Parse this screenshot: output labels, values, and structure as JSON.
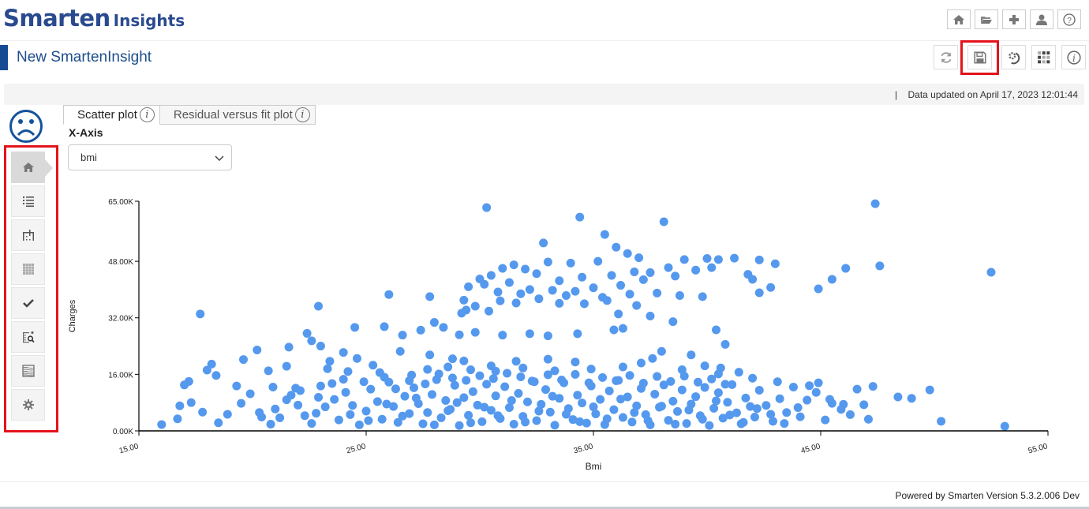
{
  "app": {
    "logo_main": "Smarten",
    "logo_sub": "Insights",
    "page_title": "New SmartenInsight",
    "top_icons": [
      "home-icon",
      "folder-open-icon",
      "plus-icon",
      "user-icon",
      "help-icon"
    ],
    "action_icons": [
      "refresh-icon",
      "save-icon",
      "settings-refresh-icon",
      "grid-icon",
      "info-icon"
    ],
    "status_separator": "|",
    "status_text": "Data updated on April 17, 2023 12:01:44",
    "footer": "Powered by Smarten Version 5.3.2.006 Dev",
    "highlight_color": "#e3141b",
    "brand_color": "#2a4a8f"
  },
  "sidebar": {
    "items": [
      {
        "name": "home",
        "icon": "home-icon",
        "active": true
      },
      {
        "name": "list",
        "icon": "list-icon"
      },
      {
        "name": "filter-columns",
        "icon": "columns-icon"
      },
      {
        "name": "table",
        "icon": "table-icon"
      },
      {
        "name": "check",
        "icon": "check-icon"
      },
      {
        "name": "explore",
        "icon": "search-data-icon"
      },
      {
        "name": "wave",
        "icon": "wave-grid-icon"
      },
      {
        "name": "settings",
        "icon": "gear-icon"
      }
    ]
  },
  "tabs": [
    {
      "label": "Scatter plot",
      "active": true
    },
    {
      "label": "Residual versus fit plot",
      "active": false
    }
  ],
  "controls": {
    "x_axis_label": "X-Axis",
    "x_axis_value": "bmi"
  },
  "chart_data": {
    "type": "scatter",
    "title": "",
    "xlabel": "Bmi",
    "ylabel": "Charges",
    "xlim": [
      15,
      55
    ],
    "ylim": [
      0,
      65000
    ],
    "x_ticks": [
      15,
      25,
      35,
      45,
      55
    ],
    "x_tick_labels": [
      "15.00",
      "25.00",
      "35.00",
      "45.00",
      "55.00"
    ],
    "y_ticks": [
      0,
      16000,
      32000,
      48000,
      65000
    ],
    "y_tick_labels": [
      "0.00K",
      "16.00K",
      "32.00K",
      "48.00K",
      "65.00K"
    ],
    "grid": false,
    "color": "#5599ee",
    "points": [
      [
        30.3,
        63200
      ],
      [
        34.4,
        60500
      ],
      [
        35.5,
        55600
      ],
      [
        38.1,
        59200
      ],
      [
        47.4,
        64300
      ],
      [
        52.5,
        44900
      ],
      [
        47.6,
        46700
      ],
      [
        46.1,
        46000
      ],
      [
        45.5,
        42900
      ],
      [
        44.9,
        40200
      ],
      [
        32.8,
        53200
      ],
      [
        17.7,
        33100
      ],
      [
        22.9,
        35300
      ],
      [
        26.0,
        38600
      ],
      [
        27.8,
        38000
      ],
      [
        53.1,
        1300
      ],
      [
        50.3,
        2700
      ],
      [
        16.0,
        1800
      ],
      [
        36.0,
        52000
      ],
      [
        36.5,
        50200
      ],
      [
        37.0,
        49000
      ],
      [
        35.2,
        48000
      ],
      [
        34.0,
        47500
      ],
      [
        33.0,
        47800
      ],
      [
        31.0,
        46000
      ],
      [
        31.5,
        47000
      ],
      [
        32.0,
        45800
      ],
      [
        32.5,
        44500
      ],
      [
        30.5,
        44000
      ],
      [
        30.0,
        43000
      ],
      [
        31.3,
        42000
      ],
      [
        33.5,
        42500
      ],
      [
        34.5,
        43500
      ],
      [
        35.8,
        44000
      ],
      [
        36.8,
        45000
      ],
      [
        37.5,
        44800
      ],
      [
        38.3,
        46200
      ],
      [
        39.0,
        48500
      ],
      [
        40.0,
        48800
      ],
      [
        40.5,
        48500
      ],
      [
        41.2,
        48900
      ],
      [
        42.3,
        48400
      ],
      [
        43.0,
        47300
      ],
      [
        39.5,
        45500
      ],
      [
        40.2,
        46200
      ],
      [
        38.6,
        43800
      ],
      [
        37.2,
        42800
      ],
      [
        36.2,
        41200
      ],
      [
        35.0,
        40500
      ],
      [
        34.2,
        39500
      ],
      [
        33.2,
        39800
      ],
      [
        32.2,
        40000
      ],
      [
        31.8,
        38800
      ],
      [
        30.8,
        39300
      ],
      [
        30.2,
        41500
      ],
      [
        29.5,
        40800
      ],
      [
        29.3,
        37000
      ],
      [
        30.9,
        36800
      ],
      [
        32.6,
        37400
      ],
      [
        33.8,
        38300
      ],
      [
        35.4,
        37800
      ],
      [
        36.6,
        38700
      ],
      [
        37.8,
        39000
      ],
      [
        38.8,
        38300
      ],
      [
        39.8,
        38000
      ],
      [
        42.3,
        39100
      ],
      [
        42.8,
        40600
      ],
      [
        41.8,
        44300
      ],
      [
        42.0,
        42900
      ],
      [
        36.9,
        35500
      ],
      [
        35.6,
        36900
      ],
      [
        34.6,
        36000
      ],
      [
        33.5,
        36100
      ],
      [
        31.6,
        36200
      ],
      [
        29.8,
        35300
      ],
      [
        29.4,
        34200
      ],
      [
        29.2,
        33300
      ],
      [
        30.4,
        33900
      ],
      [
        36.1,
        33100
      ],
      [
        37.5,
        32500
      ],
      [
        38.5,
        30900
      ],
      [
        36.3,
        29000
      ],
      [
        35.9,
        28600
      ],
      [
        34.3,
        27500
      ],
      [
        33.0,
        26900
      ],
      [
        32.2,
        27500
      ],
      [
        31.0,
        27100
      ],
      [
        29.8,
        27900
      ],
      [
        29.1,
        27200
      ],
      [
        40.4,
        28600
      ],
      [
        40.8,
        24500
      ],
      [
        39.3,
        21500
      ],
      [
        37.6,
        20500
      ],
      [
        38.0,
        22500
      ],
      [
        34.2,
        19500
      ],
      [
        33.0,
        20300
      ],
      [
        31.6,
        19700
      ],
      [
        30.5,
        18400
      ],
      [
        29.3,
        19800
      ],
      [
        28.8,
        20400
      ],
      [
        27.8,
        21500
      ],
      [
        26.5,
        22500
      ],
      [
        26.6,
        27100
      ],
      [
        27.4,
        28500
      ],
      [
        28.0,
        30700
      ],
      [
        28.4,
        29300
      ],
      [
        25.8,
        29500
      ],
      [
        24.5,
        29300
      ],
      [
        22.4,
        27600
      ],
      [
        22.6,
        25500
      ],
      [
        23.0,
        24000
      ],
      [
        21.6,
        23700
      ],
      [
        20.2,
        22900
      ],
      [
        19.6,
        20200
      ],
      [
        18.2,
        18900
      ],
      [
        18.0,
        17200
      ],
      [
        17.2,
        14000
      ],
      [
        17.0,
        13000
      ],
      [
        18.4,
        15700
      ],
      [
        19.3,
        12700
      ],
      [
        20.9,
        12400
      ],
      [
        20.7,
        17000
      ],
      [
        21.5,
        18300
      ],
      [
        23.4,
        19700
      ],
      [
        24.0,
        22200
      ],
      [
        24.6,
        20500
      ],
      [
        25.3,
        18600
      ],
      [
        25.6,
        16500
      ],
      [
        26.9,
        14200
      ],
      [
        16.7,
        3400
      ],
      [
        16.8,
        7100
      ],
      [
        17.3,
        8000
      ],
      [
        17.8,
        5300
      ],
      [
        18.5,
        2300
      ],
      [
        18.9,
        4700
      ],
      [
        19.5,
        7800
      ],
      [
        19.9,
        10500
      ],
      [
        20.4,
        3900
      ],
      [
        20.8,
        1900
      ],
      [
        21.0,
        6200
      ],
      [
        21.5,
        8800
      ],
      [
        21.9,
        12100
      ],
      [
        22.3,
        4300
      ],
      [
        22.6,
        2100
      ],
      [
        22.9,
        9500
      ],
      [
        23.2,
        6800
      ],
      [
        23.5,
        13400
      ],
      [
        23.8,
        3100
      ],
      [
        24.1,
        10900
      ],
      [
        24.4,
        7200
      ],
      [
        24.7,
        1700
      ],
      [
        25.0,
        5600
      ],
      [
        25.2,
        11800
      ],
      [
        25.5,
        8300
      ],
      [
        25.7,
        3300
      ],
      [
        26.0,
        13800
      ],
      [
        26.2,
        6900
      ],
      [
        26.4,
        2400
      ],
      [
        26.7,
        9800
      ],
      [
        26.9,
        4900
      ],
      [
        27.1,
        12200
      ],
      [
        27.3,
        7700
      ],
      [
        27.5,
        2000
      ],
      [
        27.7,
        5200
      ],
      [
        27.9,
        10300
      ],
      [
        28.1,
        14500
      ],
      [
        28.3,
        3700
      ],
      [
        28.5,
        8600
      ],
      [
        28.7,
        6100
      ],
      [
        28.9,
        12900
      ],
      [
        29.1,
        1500
      ],
      [
        29.3,
        9400
      ],
      [
        29.5,
        4400
      ],
      [
        29.7,
        11100
      ],
      [
        29.9,
        7300
      ],
      [
        30.1,
        2600
      ],
      [
        30.3,
        13200
      ],
      [
        30.5,
        5800
      ],
      [
        30.7,
        9900
      ],
      [
        30.9,
        3500
      ],
      [
        31.1,
        12500
      ],
      [
        31.3,
        6600
      ],
      [
        31.5,
        1900
      ],
      [
        31.7,
        10600
      ],
      [
        31.9,
        4100
      ],
      [
        32.1,
        8200
      ],
      [
        32.3,
        14100
      ],
      [
        32.5,
        2900
      ],
      [
        32.7,
        7500
      ],
      [
        32.9,
        11700
      ],
      [
        33.1,
        5300
      ],
      [
        33.3,
        1600
      ],
      [
        33.5,
        9200
      ],
      [
        33.7,
        13600
      ],
      [
        33.9,
        6300
      ],
      [
        34.1,
        3200
      ],
      [
        34.3,
        10100
      ],
      [
        34.5,
        7900
      ],
      [
        34.7,
        2200
      ],
      [
        34.9,
        12700
      ],
      [
        35.1,
        4800
      ],
      [
        35.3,
        8900
      ],
      [
        35.5,
        1800
      ],
      [
        35.7,
        11300
      ],
      [
        35.9,
        6000
      ],
      [
        36.1,
        14300
      ],
      [
        36.3,
        3800
      ],
      [
        36.5,
        9600
      ],
      [
        36.7,
        2500
      ],
      [
        36.9,
        7100
      ],
      [
        37.1,
        12000
      ],
      [
        37.3,
        4600
      ],
      [
        37.5,
        1700
      ],
      [
        37.7,
        10400
      ],
      [
        37.9,
        6700
      ],
      [
        38.1,
        13000
      ],
      [
        38.3,
        3000
      ],
      [
        38.5,
        8400
      ],
      [
        38.7,
        5500
      ],
      [
        38.9,
        11600
      ],
      [
        39.1,
        2100
      ],
      [
        39.3,
        7600
      ],
      [
        39.5,
        9700
      ],
      [
        39.7,
        4300
      ],
      [
        39.9,
        12300
      ],
      [
        40.1,
        1500
      ],
      [
        40.3,
        6400
      ],
      [
        40.5,
        10800
      ],
      [
        40.7,
        3600
      ],
      [
        40.9,
        8100
      ],
      [
        41.1,
        13100
      ],
      [
        41.3,
        5100
      ],
      [
        41.5,
        2000
      ],
      [
        41.7,
        9300
      ],
      [
        41.9,
        6900
      ],
      [
        42.1,
        3900
      ],
      [
        42.3,
        11500
      ],
      [
        42.6,
        7200
      ],
      [
        42.9,
        2700
      ],
      [
        43.2,
        9100
      ],
      [
        43.5,
        5200
      ],
      [
        43.8,
        12400
      ],
      [
        44.1,
        4000
      ],
      [
        44.4,
        8700
      ],
      [
        44.8,
        10900
      ],
      [
        45.2,
        3100
      ],
      [
        45.5,
        7800
      ],
      [
        45.9,
        6100
      ],
      [
        46.3,
        4600
      ],
      [
        46.6,
        11800
      ],
      [
        46.9,
        7400
      ],
      [
        47.1,
        3300
      ],
      [
        47.3,
        12600
      ],
      [
        48.4,
        9600
      ],
      [
        49.0,
        9200
      ],
      [
        49.8,
        11600
      ],
      [
        44.9,
        13600
      ],
      [
        45.4,
        8900
      ],
      [
        46.0,
        7500
      ],
      [
        20.3,
        5200
      ],
      [
        21.2,
        3700
      ],
      [
        22.0,
        7300
      ],
      [
        22.8,
        5000
      ],
      [
        23.6,
        8900
      ],
      [
        24.3,
        4600
      ],
      [
        25.1,
        2900
      ],
      [
        25.9,
        7600
      ],
      [
        26.6,
        4200
      ],
      [
        27.2,
        9300
      ],
      [
        28.0,
        1700
      ],
      [
        28.6,
        5700
      ],
      [
        29.0,
        8000
      ],
      [
        29.6,
        2300
      ],
      [
        30.2,
        6700
      ],
      [
        30.8,
        4300
      ],
      [
        31.4,
        8600
      ],
      [
        32.0,
        2500
      ],
      [
        32.6,
        5600
      ],
      [
        33.2,
        9800
      ],
      [
        33.8,
        4700
      ],
      [
        34.4,
        2600
      ],
      [
        35.0,
        6800
      ],
      [
        35.6,
        3400
      ],
      [
        36.2,
        9000
      ],
      [
        36.8,
        5200
      ],
      [
        37.4,
        2900
      ],
      [
        38.0,
        7000
      ],
      [
        38.6,
        1900
      ],
      [
        39.2,
        5900
      ],
      [
        39.8,
        3300
      ],
      [
        40.4,
        8500
      ],
      [
        41.0,
        4500
      ],
      [
        41.6,
        2400
      ],
      [
        42.2,
        6300
      ],
      [
        42.8,
        4700
      ],
      [
        43.4,
        2100
      ],
      [
        44.0,
        6600
      ],
      [
        21.7,
        10100
      ],
      [
        22.1,
        11400
      ],
      [
        23.0,
        12700
      ],
      [
        24.0,
        14600
      ],
      [
        24.9,
        13900
      ],
      [
        25.8,
        15200
      ],
      [
        26.3,
        11900
      ],
      [
        27.0,
        15800
      ],
      [
        27.6,
        13300
      ],
      [
        28.2,
        16100
      ],
      [
        28.8,
        15000
      ],
      [
        29.4,
        14300
      ],
      [
        30.0,
        15600
      ],
      [
        30.6,
        14800
      ],
      [
        31.2,
        16300
      ],
      [
        31.8,
        15300
      ],
      [
        32.4,
        13900
      ],
      [
        33.0,
        15900
      ],
      [
        33.6,
        14400
      ],
      [
        34.2,
        16000
      ],
      [
        34.8,
        13600
      ],
      [
        35.4,
        15100
      ],
      [
        36.0,
        14200
      ],
      [
        36.6,
        15700
      ],
      [
        37.2,
        13500
      ],
      [
        37.8,
        15400
      ],
      [
        38.4,
        14000
      ],
      [
        39.0,
        15500
      ],
      [
        39.6,
        13800
      ],
      [
        40.2,
        14700
      ],
      [
        40.8,
        13200
      ],
      [
        41.4,
        16600
      ],
      [
        42.0,
        14900
      ],
      [
        43.1,
        13900
      ],
      [
        44.5,
        12800
      ],
      [
        23.3,
        17600
      ],
      [
        24.2,
        16800
      ],
      [
        27.7,
        17400
      ],
      [
        28.6,
        18100
      ],
      [
        29.6,
        17300
      ],
      [
        30.7,
        16900
      ],
      [
        31.9,
        17800
      ],
      [
        33.3,
        17000
      ],
      [
        34.9,
        17500
      ],
      [
        36.3,
        18100
      ],
      [
        37.1,
        19200
      ],
      [
        38.9,
        17300
      ],
      [
        39.9,
        18400
      ],
      [
        40.6,
        17800
      ],
      [
        40.5,
        16100
      ]
    ]
  }
}
